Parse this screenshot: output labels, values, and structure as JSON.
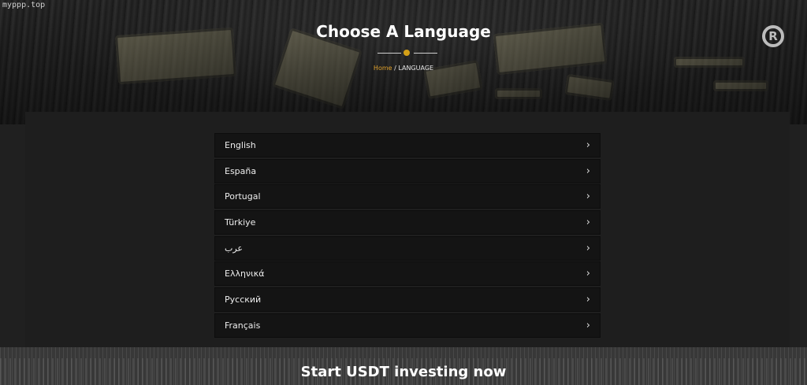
{
  "watermark": "myppp.top",
  "hero": {
    "title": "Choose A Language",
    "breadcrumb_home": "Home",
    "breadcrumb_separator": " / ",
    "breadcrumb_current": "LANGUAGE",
    "logo_letter": "R"
  },
  "languages": [
    {
      "label": "English"
    },
    {
      "label": "España"
    },
    {
      "label": "Portugal"
    },
    {
      "label": "Türkiye"
    },
    {
      "label": "عرب"
    },
    {
      "label": "Ελληνικά"
    },
    {
      "label": "Русский"
    },
    {
      "label": "Français"
    }
  ],
  "chevron": "›",
  "footer": {
    "title": "Start USDT investing now"
  },
  "colors": {
    "accent": "#e0a12b",
    "background": "#202020",
    "item_bg": "#141414"
  }
}
